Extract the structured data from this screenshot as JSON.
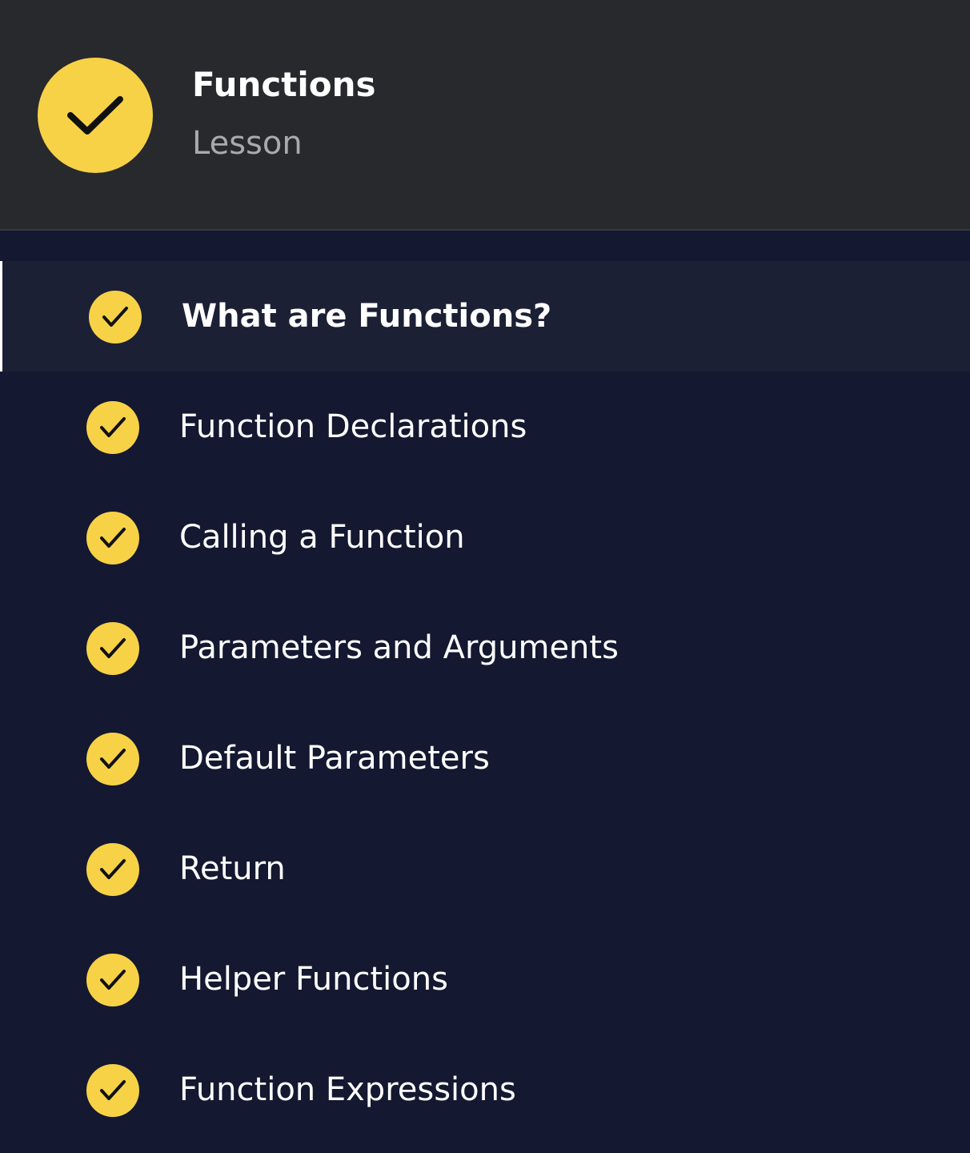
{
  "colors": {
    "accent": "#f7d247",
    "header_bg": "#28292d",
    "list_bg": "#141830",
    "active_bg": "#1c2035",
    "text_primary": "#ffffff",
    "text_muted": "#a9a9ae",
    "check_mark": "#111111"
  },
  "lesson": {
    "title": "Functions",
    "type": "Lesson",
    "status_icon": "check-icon",
    "completed": true
  },
  "items": [
    {
      "label": "What are Functions?",
      "completed": true,
      "active": true,
      "icon": "check-icon"
    },
    {
      "label": "Function Declarations",
      "completed": true,
      "active": false,
      "icon": "check-icon"
    },
    {
      "label": "Calling a Function",
      "completed": true,
      "active": false,
      "icon": "check-icon"
    },
    {
      "label": "Parameters and Arguments",
      "completed": true,
      "active": false,
      "icon": "check-icon"
    },
    {
      "label": "Default Parameters",
      "completed": true,
      "active": false,
      "icon": "check-icon"
    },
    {
      "label": "Return",
      "completed": true,
      "active": false,
      "icon": "check-icon"
    },
    {
      "label": "Helper Functions",
      "completed": true,
      "active": false,
      "icon": "check-icon"
    },
    {
      "label": "Function Expressions",
      "completed": true,
      "active": false,
      "icon": "check-icon"
    }
  ]
}
